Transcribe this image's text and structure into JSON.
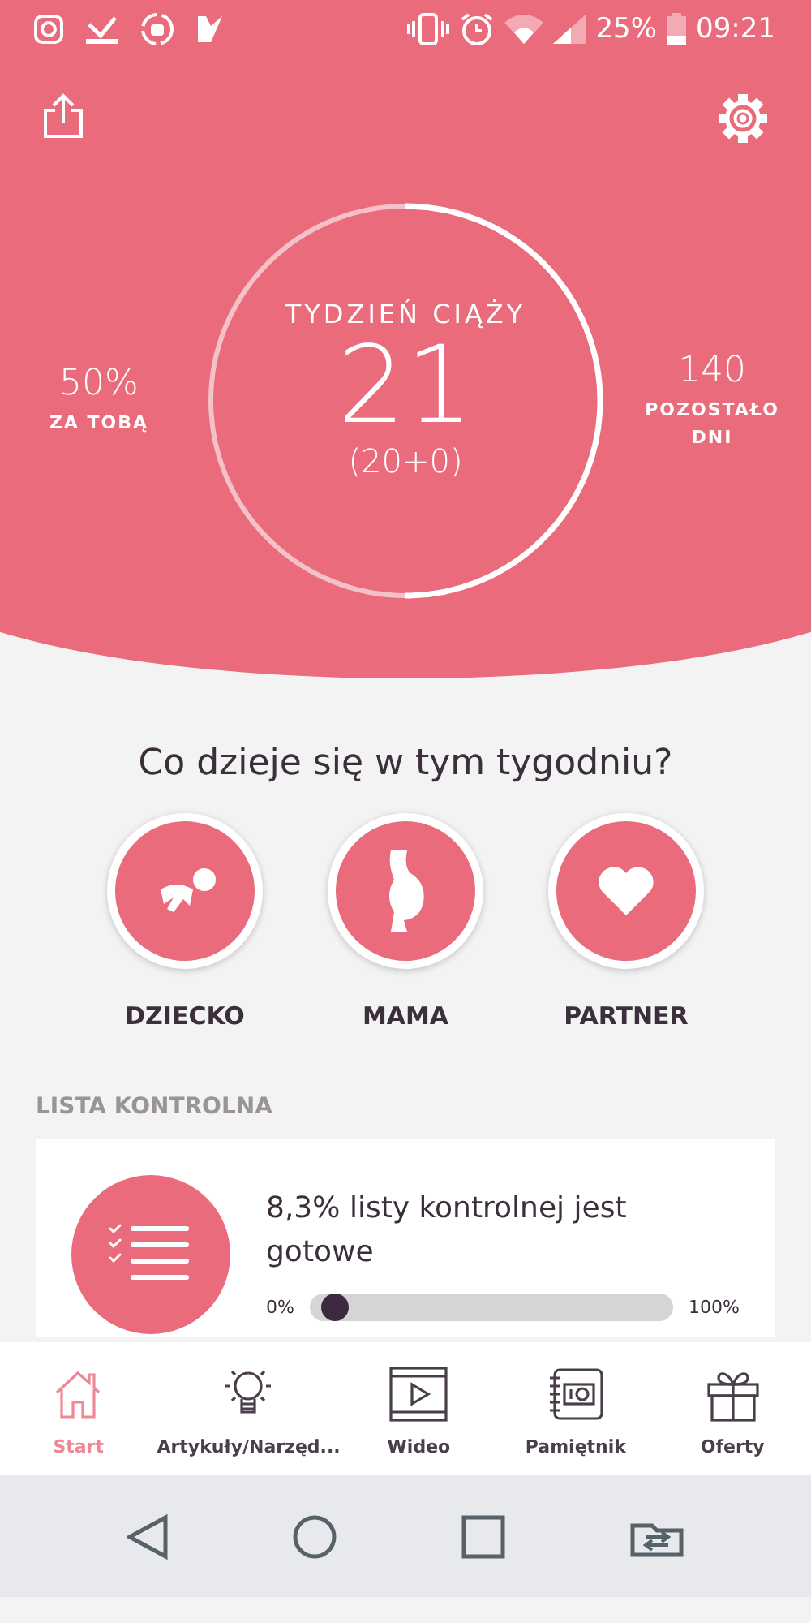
{
  "status_bar": {
    "battery": "25%",
    "time": "09:21"
  },
  "pregnancy": {
    "title": "TYDZIEŃ CIĄŻY",
    "week": "21",
    "detail": "(20+0)",
    "level": 0.5,
    "left": {
      "value": "50%",
      "label": "ZA TOBĄ"
    },
    "right": {
      "value": "140",
      "label": "POZOSTAŁO DNI"
    }
  },
  "topics": {
    "heading": "Co dzieje się w tym tygodniu?",
    "items": [
      {
        "kind": "baby",
        "label": "DZIECKO"
      },
      {
        "kind": "mom",
        "label": "MAMA"
      },
      {
        "kind": "partner",
        "label": "PARTNER"
      }
    ]
  },
  "checklist": {
    "heading": "LISTA KONTROLNA",
    "text": "8,3% listy kontrolnej jest gotowe",
    "min": "0%",
    "max": "100%",
    "level": 0.03
  },
  "tabs": [
    {
      "kind": "home",
      "label": "Start",
      "selected": true
    },
    {
      "kind": "bulb",
      "label": "Artykuły/Narzęd...",
      "selected": false
    },
    {
      "kind": "video",
      "label": "Wideo",
      "selected": false
    },
    {
      "kind": "diary",
      "label": "Pamiętnik",
      "selected": false
    },
    {
      "kind": "gift",
      "label": "Oferty",
      "selected": false
    }
  ]
}
